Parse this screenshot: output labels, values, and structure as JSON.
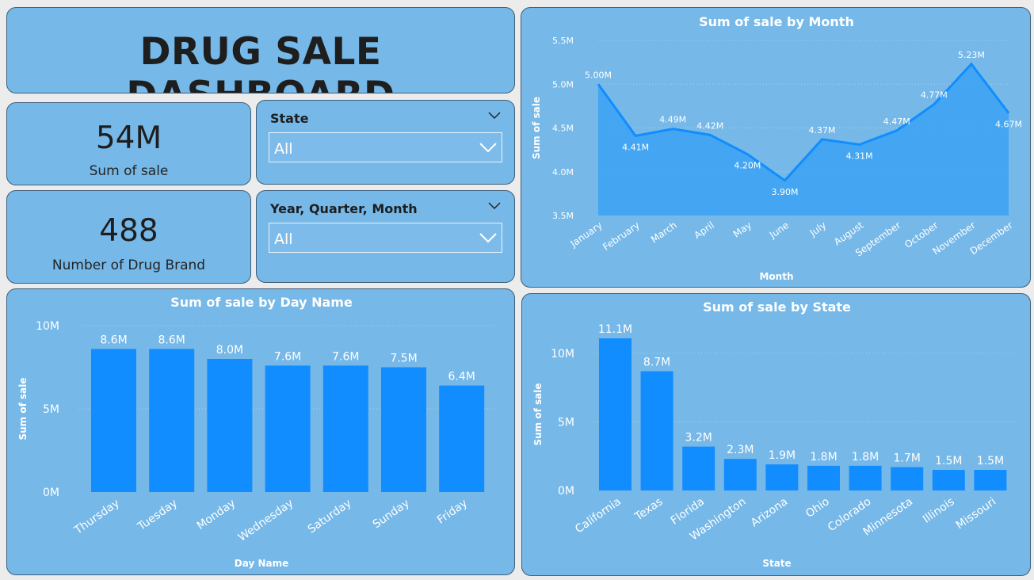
{
  "dashboard": {
    "title": "DRUG SALE DASHBOARD"
  },
  "kpis": [
    {
      "value": "54M",
      "label": "Sum of sale"
    },
    {
      "value": "488",
      "label": "Number of Drug Brand"
    }
  ],
  "slicers": [
    {
      "title": "State",
      "selected": "All"
    },
    {
      "title": "Year, Quarter, Month",
      "selected": "All"
    }
  ],
  "colors": {
    "panel": "#76b8e8",
    "bar": "#118dff",
    "line": "#118dff",
    "area": "#3fa4f3",
    "text_dark": "#1e1e1e",
    "text_light": "#ffffff"
  },
  "icons": {
    "slicer_collapse": "chevron-down-icon",
    "dropdown": "chevron-down-icon"
  },
  "chart_data": [
    {
      "type": "area",
      "title": "Sum of sale by Month",
      "xlabel": "Month",
      "ylabel": "Sum of sale",
      "ylim": [
        3.5,
        5.5
      ],
      "yticks": [
        "3.5M",
        "4.0M",
        "4.5M",
        "5.0M",
        "5.5M"
      ],
      "categories": [
        "January",
        "February",
        "March",
        "April",
        "May",
        "June",
        "July",
        "August",
        "September",
        "October",
        "November",
        "December"
      ],
      "values": [
        5.0,
        4.41,
        4.49,
        4.42,
        4.2,
        3.9,
        4.37,
        4.31,
        4.47,
        4.77,
        5.23,
        4.67
      ],
      "labels": [
        "5.00M",
        "4.41M",
        "4.49M",
        "4.42M",
        "4.20M",
        "3.90M",
        "4.37M",
        "4.31M",
        "4.47M",
        "4.77M",
        "5.23M",
        "4.67M"
      ],
      "grid": true
    },
    {
      "type": "bar",
      "title": "Sum of sale by Day Name",
      "xlabel": "Day Name",
      "ylabel": "Sum of sale",
      "ylim": [
        0,
        10
      ],
      "yticks": [
        "0M",
        "5M",
        "10M"
      ],
      "categories": [
        "Thursday",
        "Tuesday",
        "Monday",
        "Wednesday",
        "Saturday",
        "Sunday",
        "Friday"
      ],
      "values": [
        8.6,
        8.6,
        8.0,
        7.6,
        7.6,
        7.5,
        6.4
      ],
      "labels": [
        "8.6M",
        "8.6M",
        "8.0M",
        "7.6M",
        "7.6M",
        "7.5M",
        "6.4M"
      ],
      "grid": true
    },
    {
      "type": "bar",
      "title": "Sum of sale by State",
      "xlabel": "State",
      "ylabel": "Sum of sale",
      "ylim": [
        0,
        11.1
      ],
      "yticks": [
        "0M",
        "5M",
        "10M"
      ],
      "categories": [
        "California",
        "Texas",
        "Florida",
        "Washington",
        "Arizona",
        "Ohio",
        "Colorado",
        "Minnesota",
        "Illinois",
        "Missouri"
      ],
      "values": [
        11.1,
        8.7,
        3.2,
        2.3,
        1.9,
        1.8,
        1.8,
        1.7,
        1.5,
        1.5
      ],
      "labels": [
        "11.1M",
        "8.7M",
        "3.2M",
        "2.3M",
        "1.9M",
        "1.8M",
        "1.8M",
        "1.7M",
        "1.5M",
        "1.5M"
      ],
      "grid": true
    }
  ]
}
